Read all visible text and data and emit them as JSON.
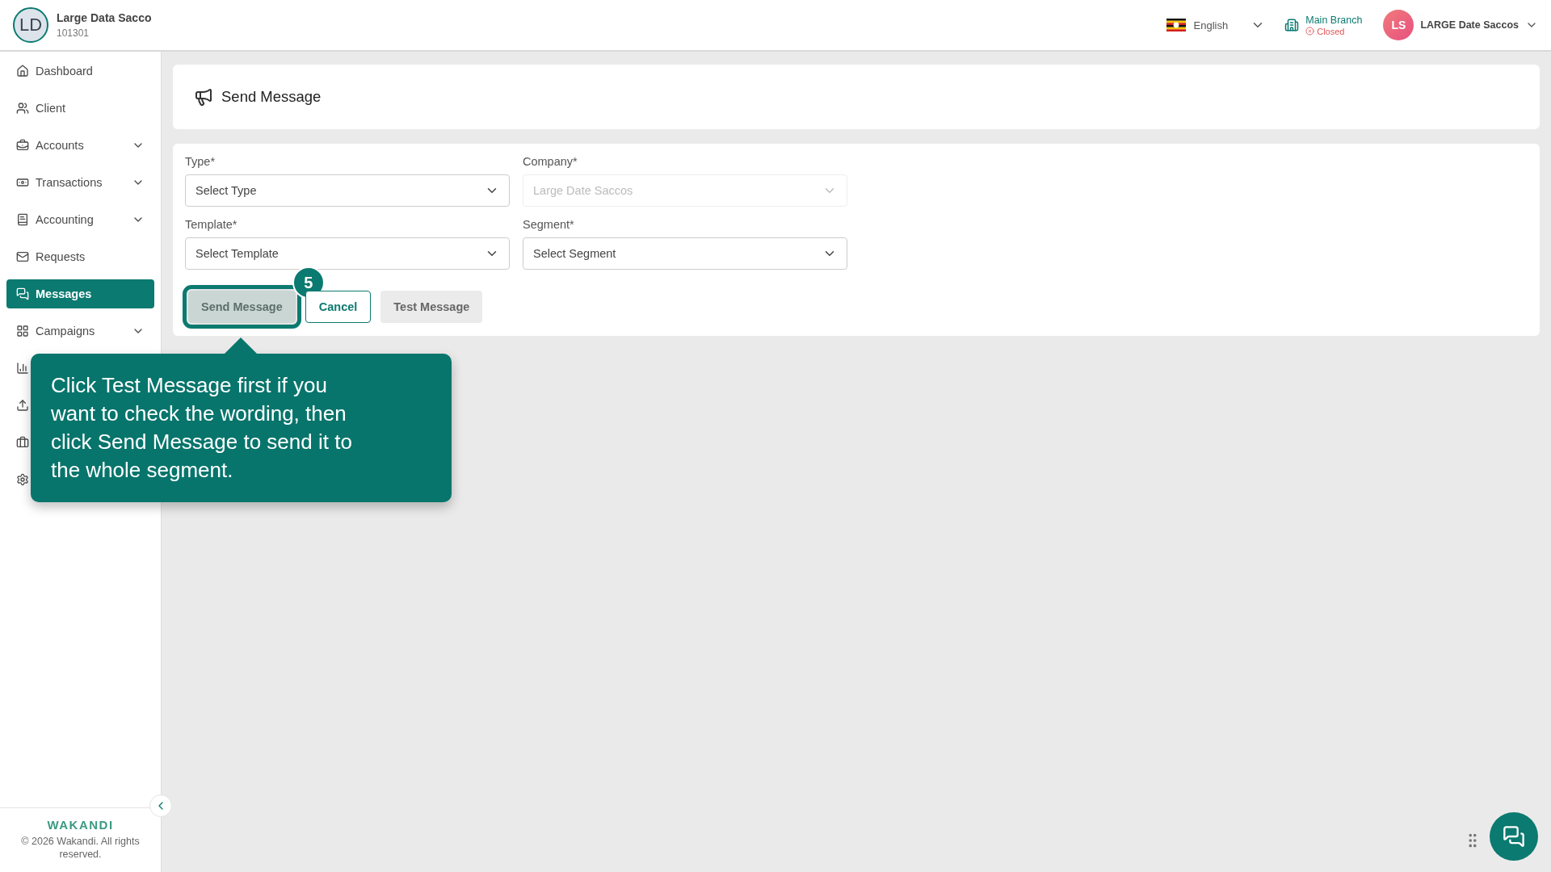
{
  "header": {
    "org_initials": "LD",
    "org_name": "Large Data Sacco",
    "org_code": "101301",
    "language": "English",
    "branch": {
      "name": "Main Branch",
      "status": "Closed"
    },
    "user": {
      "initials": "LS",
      "name": "LARGE Date Saccos"
    }
  },
  "sidebar": {
    "items": [
      {
        "label": "Dashboard",
        "expandable": false,
        "selected": false
      },
      {
        "label": "Client",
        "expandable": false,
        "selected": false
      },
      {
        "label": "Accounts",
        "expandable": true,
        "selected": false
      },
      {
        "label": "Transactions",
        "expandable": true,
        "selected": false
      },
      {
        "label": "Accounting",
        "expandable": true,
        "selected": false
      },
      {
        "label": "Requests",
        "expandable": false,
        "selected": false
      },
      {
        "label": "Messages",
        "expandable": false,
        "selected": true
      },
      {
        "label": "Campaigns",
        "expandable": true,
        "selected": false
      },
      {
        "selected": false
      },
      {
        "selected": false
      },
      {
        "selected": false
      },
      {
        "selected": false
      }
    ],
    "footer": {
      "brand": "WAKANDI",
      "copyright": "© 2026 Wakandi. All rights reserved."
    }
  },
  "page": {
    "title": "Send Message",
    "fields": [
      {
        "label": "Type*",
        "placeholder": "Select Type",
        "disabled": false
      },
      {
        "label": "Company*",
        "value": "Large Date Saccos",
        "disabled": true
      },
      {
        "label": "Template*",
        "placeholder": "Select Template",
        "disabled": false
      },
      {
        "label": "Segment*",
        "placeholder": "Select Segment",
        "disabled": false
      }
    ],
    "buttons": [
      {
        "label": "Send Message",
        "kind": "primary",
        "disabled": true,
        "highlighted": true
      },
      {
        "label": "Cancel",
        "kind": "outline",
        "disabled": false,
        "highlighted": false
      },
      {
        "label": "Test Message",
        "kind": "secondary",
        "disabled": false,
        "highlighted": false
      }
    ]
  },
  "tour": {
    "step": "5",
    "text": "Click Test Message first if you want to check the wording, then click Send Message to send it to the whole segment."
  }
}
